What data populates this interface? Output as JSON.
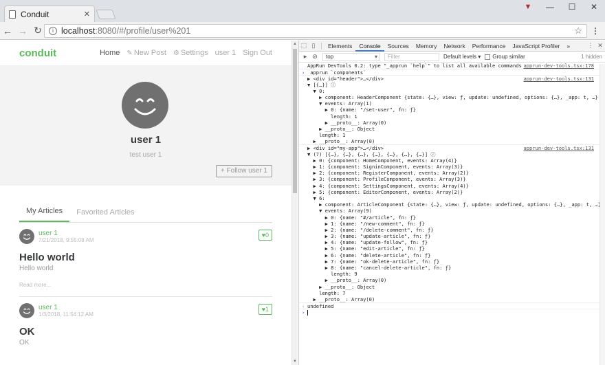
{
  "browser": {
    "tab_title": "Conduit",
    "tab_close": "✕",
    "url_host": "localhost",
    "url_rest": ":8080/#/profile/user%201",
    "win_min": "—",
    "win_max": "☐",
    "win_close": "✕",
    "back": "←",
    "forward": "→",
    "reload": "↻",
    "star": "☆",
    "menu": "⋮"
  },
  "app": {
    "brand": "conduit",
    "nav": {
      "home": "Home",
      "new_post": "New Post",
      "settings": "Settings",
      "user": "user 1",
      "sign_out": "Sign Out"
    },
    "profile": {
      "name": "user 1",
      "bio": "test user 1",
      "follow_label": "+ Follow user 1"
    },
    "tabs": {
      "my_articles": "My Articles",
      "favorited": "Favorited Articles"
    },
    "articles": [
      {
        "author": "user 1",
        "date": "7/21/2018, 9:55:08 AM",
        "favorites": "♥0",
        "title": "Hello world",
        "description": "Hello world",
        "read_more": "Read more..."
      },
      {
        "author": "user 1",
        "date": "1/3/2018, 11:54:12 AM",
        "favorites": "♥1",
        "title": "OK",
        "description": "OK"
      }
    ]
  },
  "devtools": {
    "tabs": [
      "Elements",
      "Console",
      "Sources",
      "Memory",
      "Network",
      "Performance",
      "JavaScript Profiler",
      "»"
    ],
    "active_tab": "Console",
    "context": "top",
    "filter_placeholder": "Filter",
    "levels": "Default levels ▾",
    "group_similar": "Group similar",
    "hidden_count": "1 hidden",
    "console_lines": [
      {
        "t": "AppRun DevTools 0.2: type \"_apprun `help`\" to list all available commands.",
        "src": "apprun-dev-tools.tsx:178",
        "sep": false
      },
      {
        "t": "_apprun `components`",
        "src": "",
        "cls": "prompt",
        "sep": true
      },
      {
        "t": "▶ <div id=\"header\">…</div>",
        "src": "apprun-dev-tools.tsx:131",
        "sep": true
      },
      {
        "t": "▼ [{…}] ⓘ",
        "src": "",
        "sep": false
      },
      {
        "t": "  ▼ 0:",
        "src": "",
        "sep": false
      },
      {
        "t": "    ▶ component: HeaderComponent {state: {…}, view: ƒ, update: undefined, options: {…}, _app: t, …}",
        "src": "",
        "sep": false
      },
      {
        "t": "    ▼ events: Array(1)",
        "src": "",
        "sep": false
      },
      {
        "t": "      ▶ 0: {name: \"/set-user\", fn: ƒ}",
        "src": "",
        "sep": false
      },
      {
        "t": "        length: 1",
        "src": "",
        "sep": false
      },
      {
        "t": "      ▶ __proto__: Array(0)",
        "src": "",
        "sep": false
      },
      {
        "t": "    ▶ __proto__: Object",
        "src": "",
        "sep": false
      },
      {
        "t": "    length: 1",
        "src": "",
        "sep": false
      },
      {
        "t": "  ▶ __proto__: Array(0)",
        "src": "",
        "sep": false
      },
      {
        "t": "▶ <div id=\"my-app\">…</div>",
        "src": "apprun-dev-tools.tsx:131",
        "sep": true
      },
      {
        "t": "▼ (7) [{…}, {…}, {…}, {…}, {…}, {…}, {…}] ⓘ",
        "src": "",
        "sep": false
      },
      {
        "t": "  ▶ 0: {component: HomeComponent, events: Array(4)}",
        "src": "",
        "sep": false
      },
      {
        "t": "  ▶ 1: {component: SigninComponent, events: Array(3)}",
        "src": "",
        "sep": false
      },
      {
        "t": "  ▶ 2: {component: RegisterComponent, events: Array(2)}",
        "src": "",
        "sep": false
      },
      {
        "t": "  ▶ 3: {component: ProfileComponent, events: Array(3)}",
        "src": "",
        "sep": false
      },
      {
        "t": "  ▶ 4: {component: SettingsComponent, events: Array(4)}",
        "src": "",
        "sep": false
      },
      {
        "t": "  ▶ 5: {component: EditorComponent, events: Array(2)}",
        "src": "",
        "sep": false
      },
      {
        "t": "  ▼ 6:",
        "src": "",
        "sep": false
      },
      {
        "t": "    ▶ component: ArticleComponent {state: {…}, view: ƒ, update: undefined, options: {…}, _app: t, …}",
        "src": "",
        "sep": false
      },
      {
        "t": "    ▼ events: Array(9)",
        "src": "",
        "sep": false
      },
      {
        "t": "      ▶ 0: {name: \"#/article\", fn: ƒ}",
        "src": "",
        "sep": false
      },
      {
        "t": "      ▶ 1: {name: \"/new-comment\", fn: ƒ}",
        "src": "",
        "sep": false
      },
      {
        "t": "      ▶ 2: {name: \"/delete-comment\", fn: ƒ}",
        "src": "",
        "sep": false
      },
      {
        "t": "      ▶ 3: {name: \"update-article\", fn: ƒ}",
        "src": "",
        "sep": false
      },
      {
        "t": "      ▶ 4: {name: \"update-follow\", fn: ƒ}",
        "src": "",
        "sep": false
      },
      {
        "t": "      ▶ 5: {name: \"edit-article\", fn: ƒ}",
        "src": "",
        "sep": false
      },
      {
        "t": "      ▶ 6: {name: \"delete-article\", fn: ƒ}",
        "src": "",
        "sep": false
      },
      {
        "t": "      ▶ 7: {name: \"ok-delete-article\", fn: ƒ}",
        "src": "",
        "sep": false
      },
      {
        "t": "      ▶ 8: {name: \"cancel-delete-article\", fn: ƒ}",
        "src": "",
        "sep": false
      },
      {
        "t": "        length: 9",
        "src": "",
        "sep": false
      },
      {
        "t": "      ▶ __proto__: Array(0)",
        "src": "",
        "sep": false
      },
      {
        "t": "    ▶ __proto__: Object",
        "src": "",
        "sep": false
      },
      {
        "t": "    length: 7",
        "src": "",
        "sep": false
      },
      {
        "t": "  ▶ __proto__: Array(0)",
        "src": "",
        "sep": false
      },
      {
        "t": "undefined",
        "src": "",
        "cls": "result",
        "sep": true
      },
      {
        "t": "",
        "src": "",
        "cls": "prompt",
        "sep": true,
        "cursor": true
      }
    ]
  },
  "colors": {
    "brand_green": "#5cb85c",
    "devtools_accent": "#3879d9"
  }
}
